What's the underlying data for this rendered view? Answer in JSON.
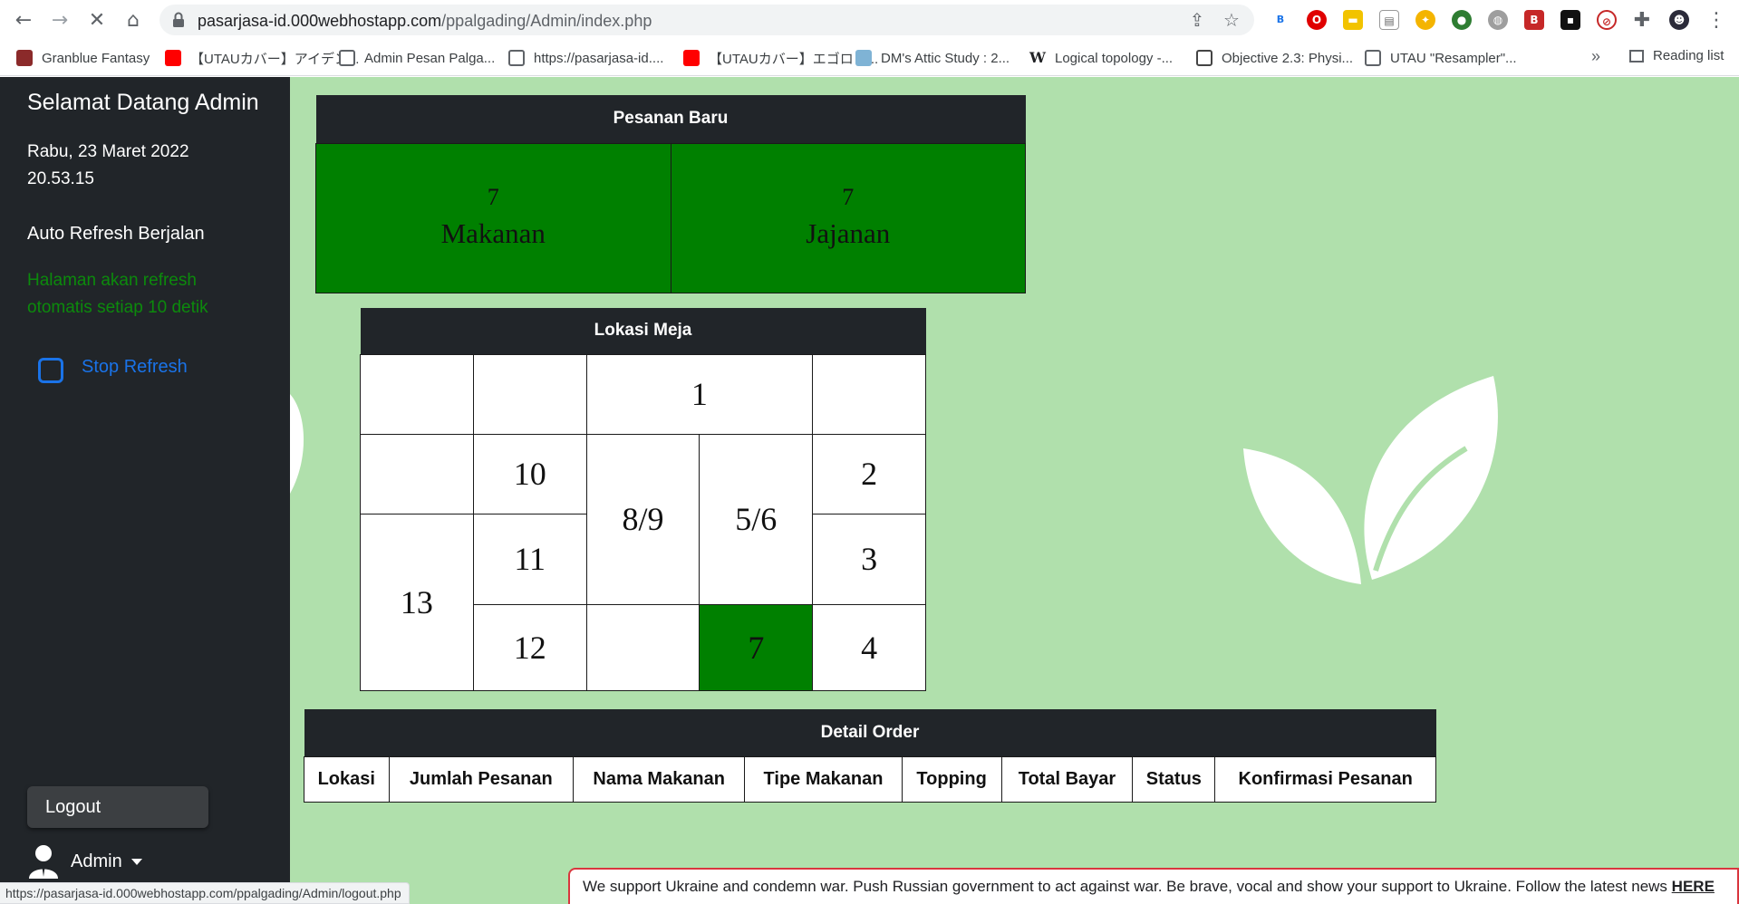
{
  "browser": {
    "url_host": "pasarjasa-id.000webhostapp.com",
    "url_path": "/ppalgading/Admin/index.php",
    "bookmarks": [
      {
        "label": "Granblue Fantasy",
        "icon": "granblue-icon"
      },
      {
        "label": "【UTAUカバー】アイデン...",
        "icon": "youtube-icon"
      },
      {
        "label": "Admin Pesan Palga...",
        "icon": "globe-icon"
      },
      {
        "label": "https://pasarjasa-id....",
        "icon": "globe-icon"
      },
      {
        "label": "【UTAUカバー】エゴロッ...",
        "icon": "youtube-icon"
      },
      {
        "label": "DM's Attic Study : 2...",
        "icon": "dm-icon"
      },
      {
        "label": "Logical topology -...",
        "icon": "wikipedia-icon"
      },
      {
        "label": "Objective 2.3: Physi...",
        "icon": "objective-icon"
      },
      {
        "label": "UTAU \"Resampler\"...",
        "icon": "globe-icon"
      }
    ],
    "overflow": "»",
    "reading_list": "Reading list",
    "status_url": "https://pasarjasa-id.000webhostapp.com/ppalgading/Admin/logout.php"
  },
  "sidebar": {
    "title": "Selamat Datang Admin",
    "date": "Rabu, 23 Maret 2022",
    "time": "20.53.15",
    "auto_refresh": "Auto Refresh Berjalan",
    "note": "Halaman akan refresh otomatis setiap 10 detik",
    "stop_refresh": "Stop Refresh",
    "logout": "Logout",
    "user": "Admin"
  },
  "pesanan_baru": {
    "title": "Pesanan Baru",
    "makanan": {
      "count": "7",
      "label": "Makanan"
    },
    "jajanan": {
      "count": "7",
      "label": "Jajanan"
    }
  },
  "lokasi_meja": {
    "title": "Lokasi Meja",
    "tables": {
      "t1": "1",
      "t2": "2",
      "t3": "3",
      "t4": "4",
      "t56": "5/6",
      "t7": "7",
      "t89": "8/9",
      "t10": "10",
      "t11": "11",
      "t12": "12",
      "t13": "13"
    },
    "highlighted": "7"
  },
  "detail_order": {
    "title": "Detail Order",
    "columns": [
      "Lokasi",
      "Jumlah Pesanan",
      "Nama Makanan",
      "Tipe Makanan",
      "Topping",
      "Total Bayar",
      "Status",
      "Konfirmasi Pesanan"
    ]
  },
  "banner": {
    "text": "We support Ukraine and condemn war. Push Russian government to act against war. Be brave, vocal and show your support to Ukraine. Follow the latest news",
    "link": "HERE"
  },
  "colors": {
    "page_bg": "#b0e0ac",
    "sidebar_bg": "#212529",
    "cell_green": "#008000",
    "accent_blue": "#1a73e8"
  }
}
